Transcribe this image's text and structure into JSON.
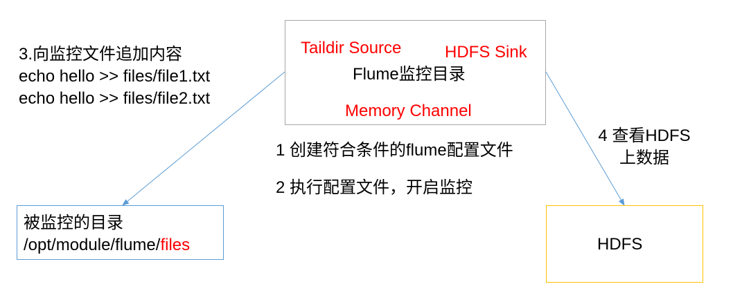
{
  "flume_box": {
    "source_label": "Taildir Source",
    "sink_label": "HDFS Sink",
    "title": "Flume监控目录",
    "channel_label": "Memory Channel"
  },
  "step3": {
    "title": "3.向监控文件追加内容",
    "cmd1": "echo hello >> files/file1.txt",
    "cmd2": "echo hello >> files/file2.txt"
  },
  "step1": {
    "text": "1 创建符合条件的flume配置文件"
  },
  "step2": {
    "text": "2 执行配置文件，开启监控"
  },
  "step4": {
    "line1": "4 查看HDFS",
    "line2": "上数据"
  },
  "monitored_dir": {
    "title": "被监控的目录",
    "path_prefix": "/opt/module/flume/",
    "path_highlight": "files"
  },
  "hdfs_box": {
    "label": "HDFS"
  },
  "colors": {
    "highlight": "#ff0000",
    "flume_border": "#a6a6a6",
    "monitored_border": "#5b9bd5",
    "hdfs_border": "#ffc000",
    "arrow": "#5b9bd5"
  }
}
